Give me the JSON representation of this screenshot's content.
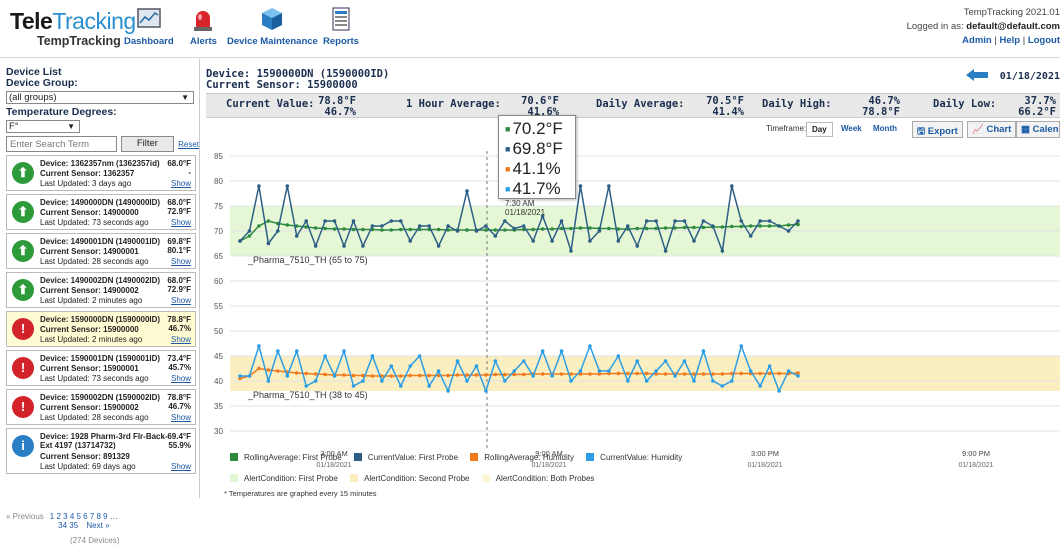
{
  "header": {
    "logo_tele": "Tele",
    "logo_tracking": "Tracking",
    "logo_sub": "TempTracking",
    "nav": [
      {
        "label": "Dashboard",
        "icon": "dashboard-icon"
      },
      {
        "label": "Alerts",
        "icon": "siren-icon"
      },
      {
        "label": "Device Maintenance",
        "icon": "cube-icon"
      },
      {
        "label": "Reports",
        "icon": "report-icon"
      }
    ],
    "version": "TempTracking 2021.01",
    "logged_in_label": "Logged in as:",
    "user": "default@default.com",
    "links": [
      "Admin",
      "Help",
      "Logout"
    ]
  },
  "sidebar": {
    "title": "Device List",
    "group_label": "Device Group:",
    "group_value": "(all groups)",
    "degrees_label": "Temperature Degrees:",
    "degrees_value": "F°",
    "search_placeholder": "Enter Search Term",
    "filter_label": "Filter",
    "reset_label": "Reset",
    "devices": [
      {
        "name": "Device: 1362357nm (1362357id)",
        "sensor": "Current Sensor: 1362357",
        "updated": "Last Updated: 3 days ago",
        "v1": "68.0°F",
        "v2": "-",
        "status": "ok",
        "show": "Show"
      },
      {
        "name": "Device: 1490000DN (1490000ID)",
        "sensor": "Current Sensor: 14900000",
        "updated": "Last Updated: 73 seconds ago",
        "v1": "68.0°F",
        "v2": "72.9°F",
        "status": "ok",
        "show": "Show"
      },
      {
        "name": "Device: 1490001DN (1490001ID)",
        "sensor": "Current Sensor: 14900001",
        "updated": "Last Updated: 28 seconds ago",
        "v1": "69.8°F",
        "v2": "80.1°F",
        "status": "ok",
        "show": "Show"
      },
      {
        "name": "Device: 1490002DN (1490002ID)",
        "sensor": "Current Sensor: 14900002",
        "updated": "Last Updated: 2 minutes ago",
        "v1": "68.0°F",
        "v2": "72.9°F",
        "status": "ok",
        "show": "Show"
      },
      {
        "name": "Device: 1590000DN (1590000ID)",
        "sensor": "Current Sensor: 15900000",
        "updated": "Last Updated: 2 minutes ago",
        "v1": "78.8°F",
        "v2": "46.7%",
        "status": "alert",
        "show": "Show",
        "selected": true
      },
      {
        "name": "Device: 1590001DN (1590001ID)",
        "sensor": "Current Sensor: 15900001",
        "updated": "Last Updated: 73 seconds ago",
        "v1": "73.4°F",
        "v2": "45.7%",
        "status": "alert",
        "show": "Show"
      },
      {
        "name": "Device: 1590002DN (1590002ID)",
        "sensor": "Current Sensor: 15900002",
        "updated": "Last Updated: 28 seconds ago",
        "v1": "78.8°F",
        "v2": "46.7%",
        "status": "alert",
        "show": "Show"
      },
      {
        "name": "Device: 1928 Pharm-3rd Flr-Back-Ext 4197 (13714732)",
        "sensor": "Current Sensor: 891329",
        "updated": "Last Updated: 69 days ago",
        "v1": "69.4°F",
        "v2": "55.9%",
        "status": "info",
        "show": "Show"
      }
    ],
    "pager_prev": "« Previous",
    "pager_pages": "1 2 3 4 5 6 7 8 9 …",
    "pager_pages2": "34 35",
    "pager_next": "Next »",
    "total": "(274 Devices)"
  },
  "main": {
    "device_title": "Device: 1590000DN (1590000ID)",
    "sensor_title": "Current Sensor: 15900000",
    "date": "01/18/2021",
    "stats": [
      {
        "label": "Current Value:",
        "v1": "78.8°F",
        "v2": "46.7%"
      },
      {
        "label": "1 Hour Average:",
        "v1": "70.6°F",
        "v2": "41.6%"
      },
      {
        "label": "Daily Average:",
        "v1": "70.5°F",
        "v2": "41.4%"
      },
      {
        "label": "Daily High:",
        "v1": "46.7%",
        "v2": "78.8°F"
      },
      {
        "label": "Daily Low:",
        "v1": "37.7%",
        "v2": "66.2°F"
      }
    ],
    "timeframe_label": "Timeframe:",
    "timeframes": [
      "Day",
      "Week",
      "Month"
    ],
    "buttons": [
      "Export",
      "Chart",
      "Calendar"
    ],
    "tooltip": {
      "values": [
        "70.2°F",
        "69.8°F",
        "41.1%",
        "41.7%"
      ],
      "time": "7:30 AM",
      "date": "01/18/2021"
    },
    "footnote": "* Temperatures are graphed every 15 minutes"
  },
  "chart_data": {
    "type": "line",
    "yticks": [
      30,
      35,
      40,
      45,
      50,
      55,
      60,
      65,
      70,
      75,
      80,
      85
    ],
    "ylim": [
      28,
      88
    ],
    "xticks": [
      {
        "time": "3:00 AM",
        "date": "01/18/2021"
      },
      {
        "time": "9:00 AM",
        "date": "01/18/2021"
      },
      {
        "time": "3:00 PM",
        "date": "01/18/2021"
      },
      {
        "time": "9:00 PM",
        "date": "01/18/2021"
      }
    ],
    "bands": [
      {
        "name": "_Pharma_7510_TH (65 to 75)",
        "from": 65,
        "to": 75,
        "color": "#e6f7d6"
      },
      {
        "name": "_Pharma_7510_TH (38 to 45)",
        "from": 38,
        "to": 45,
        "color": "#fbeec0"
      }
    ],
    "series": [
      {
        "name": "RollingAverage: First Probe",
        "color": "#2e8b3e",
        "values": [
          68,
          69,
          71,
          72,
          71.5,
          71.2,
          71,
          70.8,
          70.6,
          70.5,
          70.4,
          70.4,
          70.3,
          70.3,
          70.3,
          70.2,
          70.2,
          70.3,
          70.3,
          70.3,
          70.3,
          70.3,
          70.2,
          70.2,
          70.2,
          70.2,
          70.2,
          70.2,
          70.2,
          70.2,
          70.3,
          70.3,
          70.4,
          70.4,
          70.5,
          70.5,
          70.6,
          70.6,
          70.5,
          70.5,
          70.4,
          70.4,
          70.5,
          70.5,
          70.5,
          70.6,
          70.6,
          70.7,
          70.7,
          70.7,
          70.8,
          70.8,
          70.9,
          70.9,
          71,
          71,
          71,
          71,
          71.2,
          71.3
        ]
      },
      {
        "name": "CurrentValue: First Probe",
        "color": "#2d5f86",
        "values": [
          68,
          70,
          79,
          67.5,
          70,
          79,
          69,
          72,
          67,
          72,
          72,
          67,
          72,
          67,
          71,
          71,
          72,
          72,
          68,
          71,
          71,
          67,
          71,
          70,
          78,
          70,
          71,
          69,
          72,
          70.5,
          71,
          68,
          73,
          68,
          72,
          66,
          79,
          68,
          70,
          79,
          68,
          71,
          67,
          72,
          72,
          66,
          72,
          72,
          68,
          72,
          71,
          66,
          79,
          72,
          69,
          72,
          72,
          71,
          70,
          72
        ]
      },
      {
        "name": "RollingAverage: Humidity",
        "color": "#f07b1f",
        "values": [
          40.5,
          41,
          42.5,
          42.2,
          42,
          41.8,
          41.6,
          41.5,
          41.4,
          41.3,
          41.2,
          41.2,
          41.1,
          41.1,
          41,
          41,
          41,
          41,
          41.1,
          41.1,
          41.1,
          41.1,
          41.1,
          41.2,
          41.2,
          41.2,
          41.2,
          41.3,
          41.3,
          41.3,
          41.3,
          41.4,
          41.4,
          41.4,
          41.4,
          41.4,
          41.4,
          41.4,
          41.4,
          41.5,
          41.5,
          41.5,
          41.5,
          41.5,
          41.4,
          41.4,
          41.4,
          41.4,
          41.4,
          41.4,
          41.4,
          41.4,
          41.5,
          41.5,
          41.5,
          41.5,
          41.5,
          41.5,
          41.5,
          41.6
        ]
      },
      {
        "name": "CurrentValue: Humidity",
        "color": "#2b9ee6",
        "values": [
          41,
          41,
          47,
          40,
          46,
          41,
          46,
          39,
          40,
          45,
          41,
          46,
          39,
          40,
          45,
          40,
          43,
          39,
          43,
          45,
          39,
          42,
          38,
          44,
          40,
          43,
          38,
          44,
          40,
          42,
          44,
          41,
          46,
          41,
          46,
          40,
          42,
          47,
          42,
          42,
          45,
          40,
          44,
          40,
          42,
          44,
          41,
          44,
          40,
          46,
          40,
          39,
          40,
          47,
          42,
          39,
          43,
          38,
          42,
          41
        ]
      }
    ],
    "alert_legend": [
      "AlertCondition: First Probe",
      "AlertCondition: Second Probe",
      "AlertCondition: Both Probes"
    ]
  }
}
